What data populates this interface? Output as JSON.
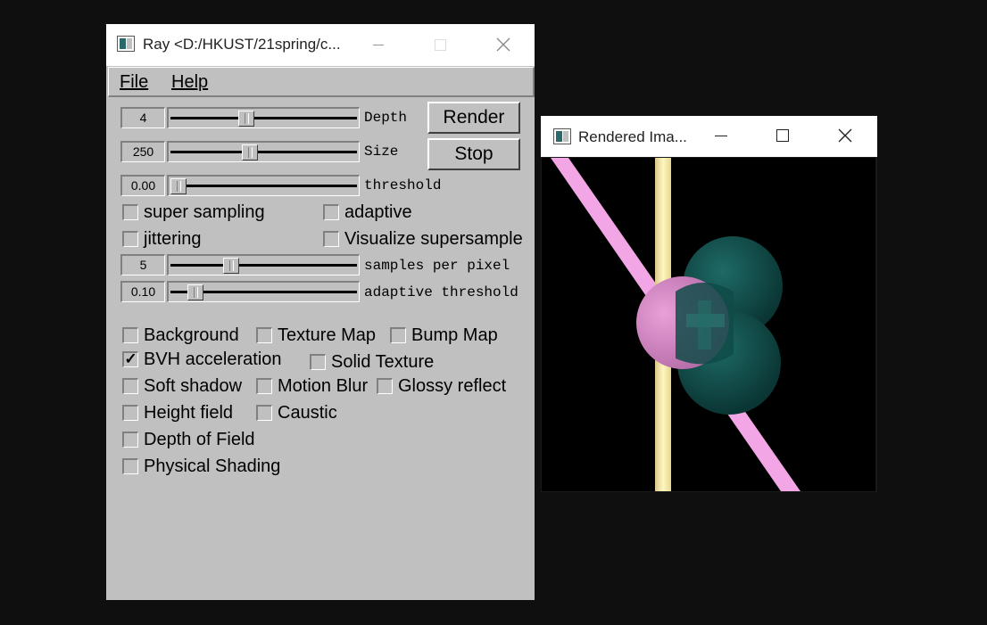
{
  "ray_window": {
    "title": "Ray <D:/HKUST/21spring/c...",
    "menu": {
      "file": "File",
      "help": "Help"
    },
    "sliders": {
      "depth": {
        "value": "4",
        "label": "Depth",
        "fraction": 0.4
      },
      "size": {
        "value": "250",
        "label": "Size",
        "fraction": 0.42
      },
      "threshold": {
        "value": "0.00",
        "label": "threshold",
        "fraction": 0.0
      },
      "samples": {
        "value": "5",
        "label": "samples per pixel",
        "fraction": 0.31
      },
      "adaptive_threshold": {
        "value": "0.10",
        "label": "adaptive threshold",
        "fraction": 0.1
      }
    },
    "buttons": {
      "render": "Render",
      "stop": "Stop"
    },
    "checkboxes": {
      "super_sampling": {
        "label": "super sampling",
        "checked": false
      },
      "adaptive": {
        "label": "adaptive",
        "checked": false
      },
      "jittering": {
        "label": "jittering",
        "checked": false
      },
      "visualize_supersample": {
        "label": "Visualize supersample",
        "checked": false
      },
      "background": {
        "label": "Background",
        "checked": false
      },
      "texture_map": {
        "label": "Texture Map",
        "checked": false
      },
      "bump_map": {
        "label": "Bump Map",
        "checked": false
      },
      "bvh": {
        "label": "BVH acceleration",
        "checked": true
      },
      "solid_texture": {
        "label": "Solid Texture",
        "checked": false
      },
      "soft_shadow": {
        "label": "Soft shadow",
        "checked": false
      },
      "motion_blur": {
        "label": "Motion Blur",
        "checked": false
      },
      "glossy_reflect": {
        "label": "Glossy reflect",
        "checked": false
      },
      "height_field": {
        "label": "Height field",
        "checked": false
      },
      "caustic": {
        "label": "Caustic",
        "checked": false
      },
      "depth_of_field": {
        "label": "Depth of Field",
        "checked": false
      },
      "physical_shading": {
        "label": "Physical Shading",
        "checked": false
      }
    }
  },
  "render_window": {
    "title": "Rendered Ima..."
  },
  "colors": {
    "desktop": "#0f0f0f",
    "panel": "#c0c0c0",
    "pink_cylinder": "#f2a6e6",
    "yellow_cylinder": "#fff0a0",
    "teal_sphere": "#0e4a48"
  }
}
